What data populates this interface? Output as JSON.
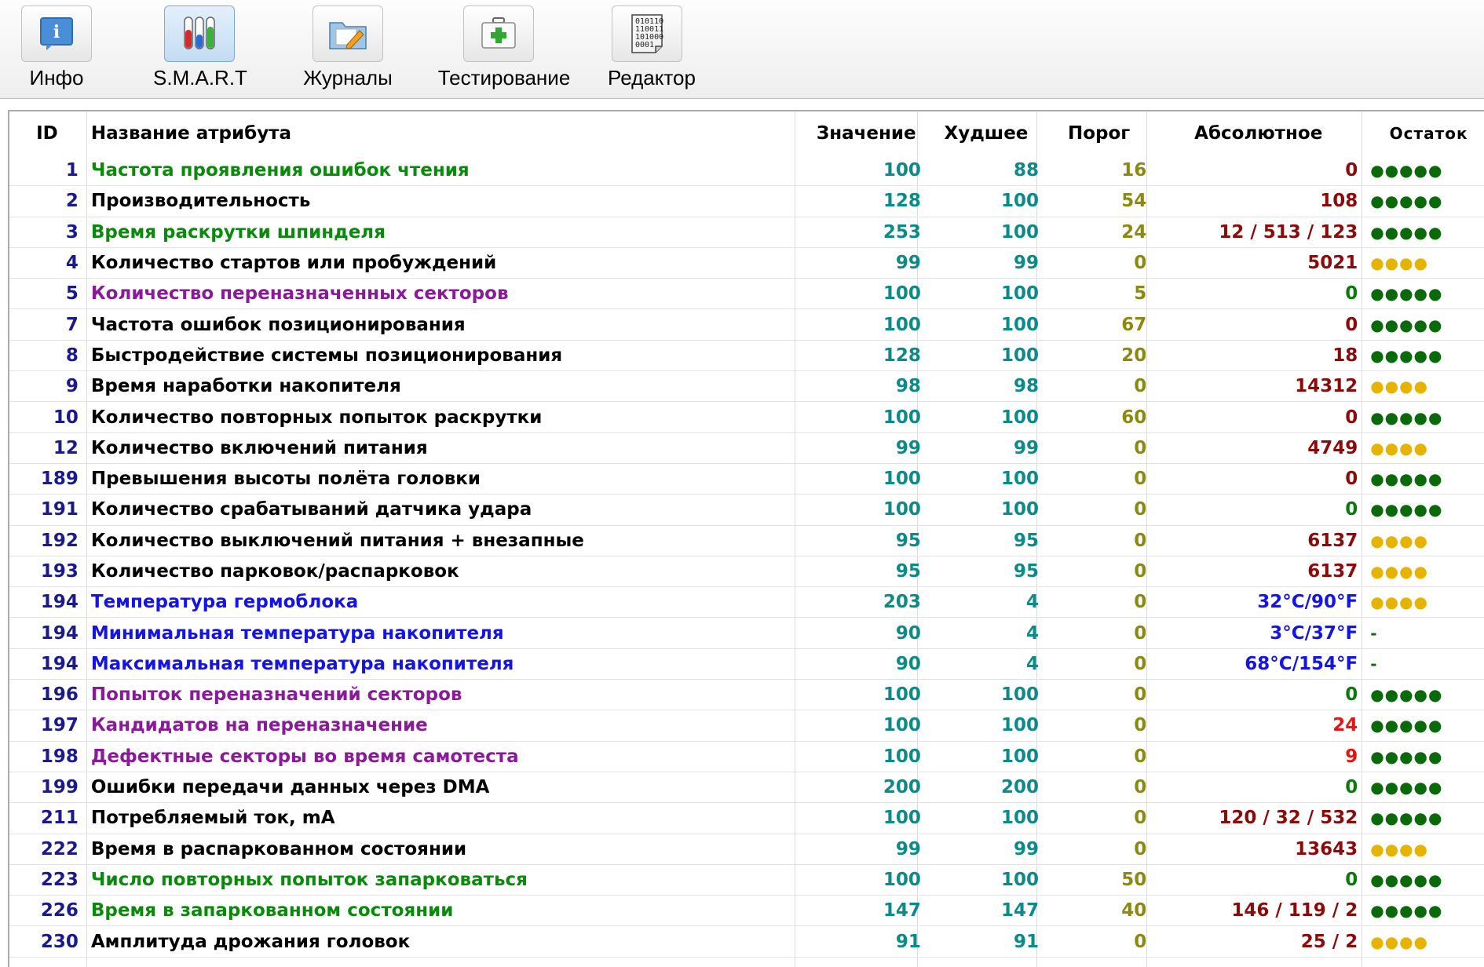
{
  "toolbar": {
    "buttons": [
      {
        "label": "Инфо",
        "icon": "info-icon"
      },
      {
        "label": "S.M.A.R.T",
        "icon": "test-tubes-icon",
        "active": true
      },
      {
        "label": "Журналы",
        "icon": "folder-pencil-icon"
      },
      {
        "label": "Тестирование",
        "icon": "first-aid-kit-icon"
      },
      {
        "label": "Редактор",
        "icon": "binary-editor-icon"
      }
    ]
  },
  "colors": {
    "name_normal": "#000000",
    "name_green": "#0a8a0a",
    "name_purple": "#8a1a9a",
    "name_blue": "#1414e6",
    "abs_normal": "#8b0a0a",
    "abs_green": "#0a7a0a",
    "abs_red": "#e61414",
    "abs_blue": "#1414e6",
    "dots_green": "#0a6a0a",
    "dots_yellow": "#e6b400"
  },
  "table": {
    "headers": {
      "id": "ID",
      "name": "Название атрибута",
      "value": "Значение",
      "worst": "Худшее",
      "threshold": "Порог",
      "absolute": "Абсолютное",
      "remaining": "Остаток"
    },
    "rows": [
      {
        "id": "1",
        "name": "Частота проявления ошибок чтения",
        "nameColor": "green",
        "value": "100",
        "worst": "88",
        "threshold": "16",
        "absolute": "0",
        "absColor": "normal",
        "remaining": "●●●●●",
        "remColor": "green"
      },
      {
        "id": "2",
        "name": "Производительность",
        "nameColor": "normal",
        "value": "128",
        "worst": "100",
        "threshold": "54",
        "absolute": "108",
        "absColor": "normal",
        "remaining": "●●●●●",
        "remColor": "green"
      },
      {
        "id": "3",
        "name": "Время раскрутки шпинделя",
        "nameColor": "green",
        "value": "253",
        "worst": "100",
        "threshold": "24",
        "absolute": "12 / 513 / 123",
        "absColor": "normal",
        "remaining": "●●●●●",
        "remColor": "green"
      },
      {
        "id": "4",
        "name": "Количество стартов или пробуждений",
        "nameColor": "normal",
        "value": "99",
        "worst": "99",
        "threshold": "0",
        "absolute": "5021",
        "absColor": "normal",
        "remaining": "●●●●",
        "remColor": "yellow"
      },
      {
        "id": "5",
        "name": "Количество переназначенных секторов",
        "nameColor": "purple",
        "value": "100",
        "worst": "100",
        "threshold": "5",
        "absolute": "0",
        "absColor": "green",
        "remaining": "●●●●●",
        "remColor": "green"
      },
      {
        "id": "7",
        "name": "Частота ошибок позиционирования",
        "nameColor": "normal",
        "value": "100",
        "worst": "100",
        "threshold": "67",
        "absolute": "0",
        "absColor": "normal",
        "remaining": "●●●●●",
        "remColor": "green"
      },
      {
        "id": "8",
        "name": "Быстродействие системы позиционирования",
        "nameColor": "normal",
        "value": "128",
        "worst": "100",
        "threshold": "20",
        "absolute": "18",
        "absColor": "normal",
        "remaining": "●●●●●",
        "remColor": "green"
      },
      {
        "id": "9",
        "name": "Время наработки накопителя",
        "nameColor": "normal",
        "value": "98",
        "worst": "98",
        "threshold": "0",
        "absolute": "14312",
        "absColor": "normal",
        "remaining": "●●●●",
        "remColor": "yellow"
      },
      {
        "id": "10",
        "name": "Количество повторных попыток раскрутки",
        "nameColor": "normal",
        "value": "100",
        "worst": "100",
        "threshold": "60",
        "absolute": "0",
        "absColor": "normal",
        "remaining": "●●●●●",
        "remColor": "green"
      },
      {
        "id": "12",
        "name": "Количество включений питания",
        "nameColor": "normal",
        "value": "99",
        "worst": "99",
        "threshold": "0",
        "absolute": "4749",
        "absColor": "normal",
        "remaining": "●●●●",
        "remColor": "yellow"
      },
      {
        "id": "189",
        "name": "Превышения высоты полёта головки",
        "nameColor": "normal",
        "value": "100",
        "worst": "100",
        "threshold": "0",
        "absolute": "0",
        "absColor": "normal",
        "remaining": "●●●●●",
        "remColor": "green"
      },
      {
        "id": "191",
        "name": "Количество срабатываний датчика удара",
        "nameColor": "normal",
        "value": "100",
        "worst": "100",
        "threshold": "0",
        "absolute": "0",
        "absColor": "green",
        "remaining": "●●●●●",
        "remColor": "green"
      },
      {
        "id": "192",
        "name": "Количество выключений питания + внезапные",
        "nameColor": "normal",
        "value": "95",
        "worst": "95",
        "threshold": "0",
        "absolute": "6137",
        "absColor": "normal",
        "remaining": "●●●●",
        "remColor": "yellow"
      },
      {
        "id": "193",
        "name": "Количество парковок/распарковок",
        "nameColor": "normal",
        "value": "95",
        "worst": "95",
        "threshold": "0",
        "absolute": "6137",
        "absColor": "normal",
        "remaining": "●●●●",
        "remColor": "yellow"
      },
      {
        "id": "194",
        "name": "Температура гермоблока",
        "nameColor": "blue",
        "value": "203",
        "worst": "4",
        "threshold": "0",
        "absolute": "32°C/90°F",
        "absColor": "blue",
        "remaining": "●●●●",
        "remColor": "yellow"
      },
      {
        "id": "194",
        "name": "Минимальная температура накопителя",
        "nameColor": "blue",
        "value": "90",
        "worst": "4",
        "threshold": "0",
        "absolute": "3°C/37°F",
        "absColor": "blue",
        "remaining": "-",
        "remColor": "green"
      },
      {
        "id": "194",
        "name": "Максимальная температура накопителя",
        "nameColor": "blue",
        "value": "90",
        "worst": "4",
        "threshold": "0",
        "absolute": "68°C/154°F",
        "absColor": "blue",
        "remaining": "-",
        "remColor": "green"
      },
      {
        "id": "196",
        "name": "Попыток переназначений секторов",
        "nameColor": "purple",
        "value": "100",
        "worst": "100",
        "threshold": "0",
        "absolute": "0",
        "absColor": "green",
        "remaining": "●●●●●",
        "remColor": "green"
      },
      {
        "id": "197",
        "name": "Кандидатов на переназначение",
        "nameColor": "purple",
        "value": "100",
        "worst": "100",
        "threshold": "0",
        "absolute": "24",
        "absColor": "red",
        "remaining": "●●●●●",
        "remColor": "green"
      },
      {
        "id": "198",
        "name": "Дефектные секторы во время самотеста",
        "nameColor": "purple",
        "value": "100",
        "worst": "100",
        "threshold": "0",
        "absolute": "9",
        "absColor": "red",
        "remaining": "●●●●●",
        "remColor": "green"
      },
      {
        "id": "199",
        "name": "Ошибки передачи данных через DMA",
        "nameColor": "normal",
        "value": "200",
        "worst": "200",
        "threshold": "0",
        "absolute": "0",
        "absColor": "green",
        "remaining": "●●●●●",
        "remColor": "green"
      },
      {
        "id": "211",
        "name": "Потребляемый ток, mA",
        "nameColor": "normal",
        "value": "100",
        "worst": "100",
        "threshold": "0",
        "absolute": "120 / 32 / 532",
        "absColor": "normal",
        "remaining": "●●●●●",
        "remColor": "green"
      },
      {
        "id": "222",
        "name": "Время в распаркованном состоянии",
        "nameColor": "normal",
        "value": "99",
        "worst": "99",
        "threshold": "0",
        "absolute": "13643",
        "absColor": "normal",
        "remaining": "●●●●",
        "remColor": "yellow"
      },
      {
        "id": "223",
        "name": "Число повторных попыток запарковаться",
        "nameColor": "green",
        "value": "100",
        "worst": "100",
        "threshold": "50",
        "absolute": "0",
        "absColor": "green",
        "remaining": "●●●●●",
        "remColor": "green"
      },
      {
        "id": "226",
        "name": "Время в запаркованном состоянии",
        "nameColor": "green",
        "value": "147",
        "worst": "147",
        "threshold": "40",
        "absolute": "146 / 119 / 2",
        "absColor": "normal",
        "remaining": "●●●●●",
        "remColor": "green"
      },
      {
        "id": "230",
        "name": "Амплитуда дрожания головок",
        "nameColor": "normal",
        "value": "91",
        "worst": "91",
        "threshold": "0",
        "absolute": "25 / 2",
        "absColor": "normal",
        "remaining": "●●●●",
        "remColor": "yellow"
      }
    ]
  }
}
